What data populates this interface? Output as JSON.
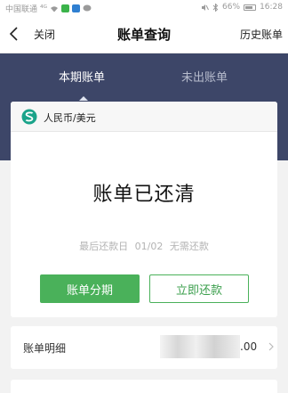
{
  "status_bar": {
    "carrier": "中国联通",
    "network": "⁴ᴳ",
    "battery": "66%",
    "time": "16:28"
  },
  "nav": {
    "close_label": "关闭",
    "title": "账单查询",
    "history_label": "历史账单"
  },
  "tabs": [
    {
      "label": "本期账单",
      "active": true
    },
    {
      "label": "未出账单",
      "active": false
    }
  ],
  "bill": {
    "currency_label": "人民币/美元",
    "status": "账单已还清",
    "due_prefix": "最后还款日",
    "due_date": "01/02",
    "due_note": "无需还款",
    "installment_button": "账单分期",
    "repay_button": "立即还款"
  },
  "detail": {
    "label": "账单明细",
    "amount_visible": ".00"
  },
  "colors": {
    "header_bg": "#3d4668",
    "accent_green": "#4ab15a",
    "bank_logo": "#1aa38a"
  }
}
